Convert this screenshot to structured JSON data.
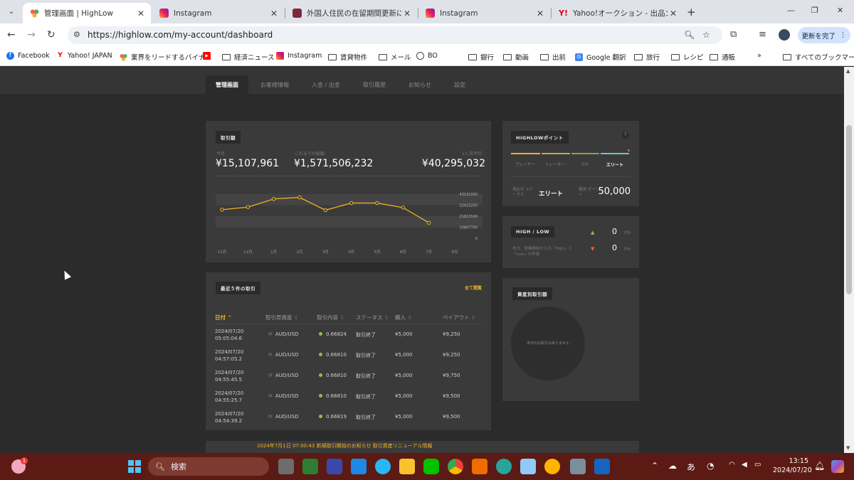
{
  "browser": {
    "tabs": [
      {
        "title": "管理画面 | HighLow",
        "active": true
      },
      {
        "title": "Instagram",
        "active": false
      },
      {
        "title": "外国人住民の在留期間更新に伴",
        "active": false
      },
      {
        "title": "Instagram",
        "active": false
      },
      {
        "title": "Yahoo!オークション - 出品：商品",
        "active": false
      }
    ],
    "url": "https://highlow.com/my-account/dashboard",
    "update_button": "更新を完了",
    "bookmarks": [
      "Facebook",
      "Yahoo! JAPAN",
      "業界をリードするバイナ...",
      "経済ニュース",
      "Instagram",
      "賃貸物件",
      "メール",
      "BO",
      "銀行",
      "動画",
      "出前",
      "Google 翻訳",
      "旅行",
      "レシピ",
      "通販"
    ],
    "all_bookmarks": "すべてのブックマーク"
  },
  "subnav": [
    "管理画面",
    "お客様情報",
    "入金 / 出金",
    "取引履歴",
    "お知らせ",
    "設定"
  ],
  "trade_amount": {
    "label": "取引額",
    "monthly_label": "今月",
    "monthly_value": "¥15,107,961",
    "total_label": "これまでの総額",
    "total_value": "¥1,571,506,232",
    "avg_label": "1ヶ月平均",
    "avg_value": "¥40,295,032"
  },
  "chart_data": {
    "type": "line",
    "categories": [
      "11月",
      "12月",
      "1月",
      "2月",
      "3月",
      "4月",
      "5月",
      "6月",
      "7月",
      "8月"
    ],
    "series": [
      {
        "values": [
          28000000,
          30500000,
          38500000,
          40000000,
          27500000,
          34500000,
          34500000,
          30000000,
          15107961,
          null
        ]
      }
    ],
    "yticks": [
      "43231000",
      "32423250",
      "21615500",
      "10807750",
      "0"
    ],
    "ylim": [
      0,
      43231000
    ],
    "color": "#f0b429"
  },
  "recent_trades": {
    "label": "最近５件の取引",
    "view_all": "全て閲覧",
    "headers": [
      "日付",
      "取引原資産",
      "取引内容",
      "ステータス",
      "購入",
      "ペイアウト"
    ],
    "rows": [
      {
        "date": "2024/07/20",
        "time": "05:05:04.6",
        "asset": "AUD/USD",
        "rate": "0.66824",
        "status": "取引終了",
        "buy": "¥5,000",
        "payout": "¥9,250"
      },
      {
        "date": "2024/07/20",
        "time": "04:57:05.2",
        "asset": "AUD/USD",
        "rate": "0.66810",
        "status": "取引終了",
        "buy": "¥5,000",
        "payout": "¥9,250"
      },
      {
        "date": "2024/07/20",
        "time": "04:55:45.5",
        "asset": "AUD/USD",
        "rate": "0.66810",
        "status": "取引終了",
        "buy": "¥5,000",
        "payout": "¥9,750"
      },
      {
        "date": "2024/07/20",
        "time": "04:55:25.7",
        "asset": "AUD/USD",
        "rate": "0.66810",
        "status": "取引終了",
        "buy": "¥5,000",
        "payout": "¥9,500"
      },
      {
        "date": "2024/07/20",
        "time": "04:54:39.2",
        "asset": "AUD/USD",
        "rate": "0.66819",
        "status": "取引終了",
        "buy": "¥5,000",
        "payout": "¥9,500"
      }
    ]
  },
  "points": {
    "label": "HIGHLOWポイント",
    "help": "?",
    "ranks": [
      "ブレーヤー",
      "トレーダー",
      "プロ",
      "エリート"
    ],
    "status_label": "現在の ステータス",
    "status_value": "エリート",
    "points_label": "獲得 ポイント",
    "points_value": "50,000"
  },
  "highlow": {
    "label": "HIGH / LOW",
    "high_count": "0",
    "high_pct": "0%",
    "low_count": "0",
    "low_pct": "0%",
    "note": "本日、営業開始からの「High」と「Low」の件数"
  },
  "asset_trades": {
    "label": "資産別取引額",
    "empty": "本日のお取引はありません"
  },
  "bottom_strip": "2024年7月1日 07:00:43 新規取引開始のお知らせ 取引資産リニューアル情報",
  "taskbar": {
    "search": "検索",
    "notification_badge": "1",
    "time": "13:15",
    "date": "2024/07/20",
    "ime": "あ"
  }
}
